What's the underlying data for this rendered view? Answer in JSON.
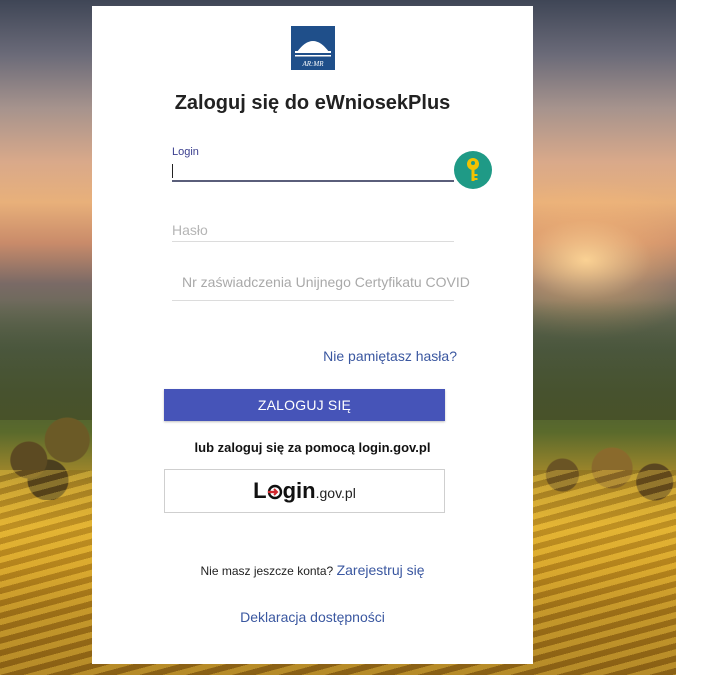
{
  "logo": {
    "text": "AR:MR"
  },
  "title": "Zaloguj się do eWniosekPlus",
  "fields": {
    "login_label": "Login",
    "login_value": "",
    "password_placeholder": "Hasło",
    "covid_placeholder": "Nr zaświadczenia Unijnego Certyfikatu COVID"
  },
  "links": {
    "forgot_password": "Nie pamiętasz hasła?",
    "no_account": "Nie masz jeszcze konta?",
    "register": "Zarejestruj się",
    "accessibility": "Deklaracja dostępności"
  },
  "buttons": {
    "login": "ZALOGUJ SIĘ",
    "alt_login_text": "lub zaloguj się za pomocą login.gov.pl",
    "gov_login_main_l": "L",
    "gov_login_main_rest": "gin",
    "gov_login_suffix": ".gov.pl"
  },
  "icons": {
    "key": "key-icon",
    "login_gov_arrow": "arrow-icon"
  },
  "colors": {
    "primary_button": "#4654b8",
    "key_button": "#1f9a86",
    "link": "#3a57a0",
    "logo_bg": "#1f4f8a",
    "login_gov_accent": "#d2282e"
  }
}
